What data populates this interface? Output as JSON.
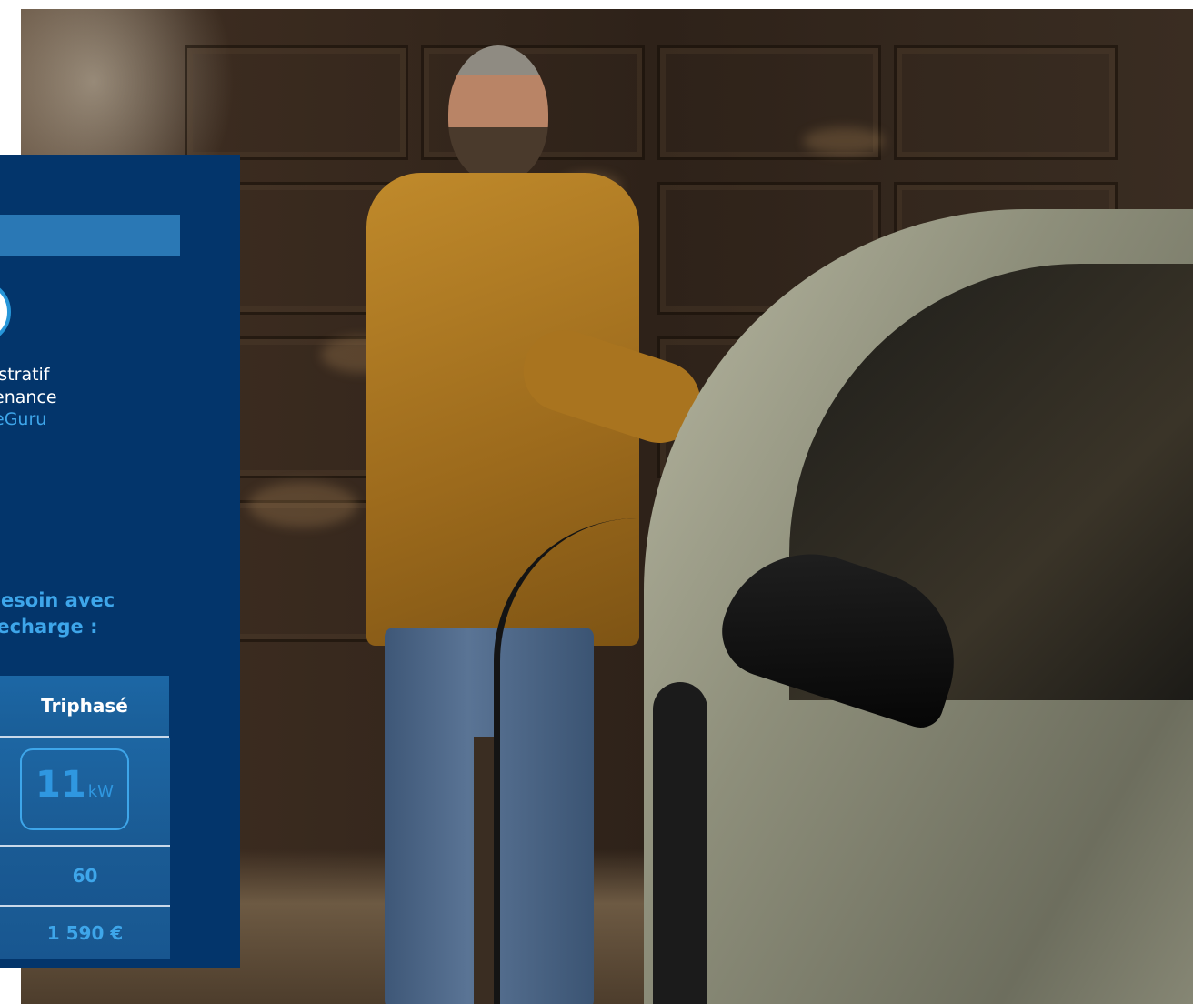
{
  "panel": {
    "features": [
      {
        "text": "istratif"
      },
      {
        "text": "enance"
      },
      {
        "text": "eGuru"
      }
    ],
    "need_lines": [
      "besoin avec",
      "recharge :"
    ],
    "table": {
      "header": "Triphasé",
      "power_value": "11",
      "power_unit": "kW",
      "row_2": "60",
      "price": "1 590 €"
    }
  },
  "colors": {
    "panel_bg": "#03356b",
    "accent_blue": "#3ea6ea",
    "bar_blue": "#2a78b5"
  }
}
